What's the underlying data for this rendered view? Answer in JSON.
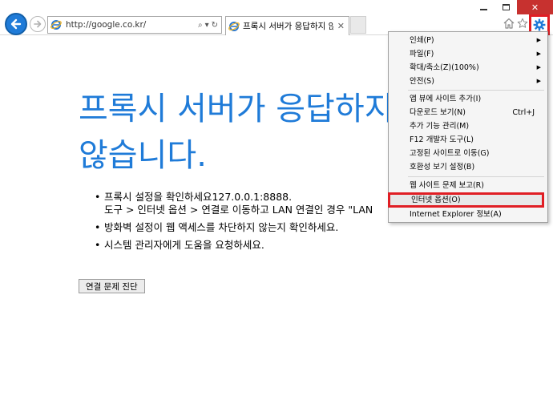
{
  "window": {
    "close_glyph": "✕"
  },
  "navbar": {
    "address": "http://google.co.kr/",
    "search_glyph": "⌕",
    "dropdown_glyph": "▾",
    "refresh_glyph": "↻",
    "tab_title": "프록시 서버가 응답하지 않...",
    "tab_close_glyph": "✕"
  },
  "page": {
    "title": "프록시 서버가 응답하지 않습니다.",
    "bullets": [
      {
        "line1": "프록시 설정을 확인하세요127.0.0.1:8888.",
        "line2": "도구 > 인터넷 옵션 > 연결로 이동하고 LAN 연결인 경우 \"LAN"
      },
      {
        "line1": "방화벽 설정이 웹 액세스를 차단하지 않는지 확인하세요."
      },
      {
        "line1": "시스템 관리자에게 도움을 요청하세요."
      }
    ],
    "diagnose_button": "연결 문제 진단"
  },
  "menu": {
    "items": [
      {
        "label": "인쇄(P)",
        "submenu": true
      },
      {
        "label": "파일(F)",
        "submenu": true
      },
      {
        "label": "확대/축소(Z)(100%)",
        "submenu": true
      },
      {
        "label": "안전(S)",
        "submenu": true
      },
      {
        "label": "앱 뷰에 사이트 추가(I)"
      },
      {
        "label": "다운로드 보기(N)",
        "shortcut": "Ctrl+J"
      },
      {
        "label": "추가 기능 관리(M)"
      },
      {
        "label": "F12 개발자 도구(L)"
      },
      {
        "label": "고정된 사이트로 이동(G)"
      },
      {
        "label": "호환성 보기 설정(B)"
      },
      {
        "label": "웹 사이트 문제 보고(R)"
      },
      {
        "label": "인터넷 옵션(O)"
      },
      {
        "label": "Internet Explorer 정보(A)"
      }
    ],
    "submenu_glyph": "▶"
  },
  "colors": {
    "accent": "#1f7bd8",
    "highlight_border": "#e01e24",
    "close_button": "#c7312f"
  }
}
